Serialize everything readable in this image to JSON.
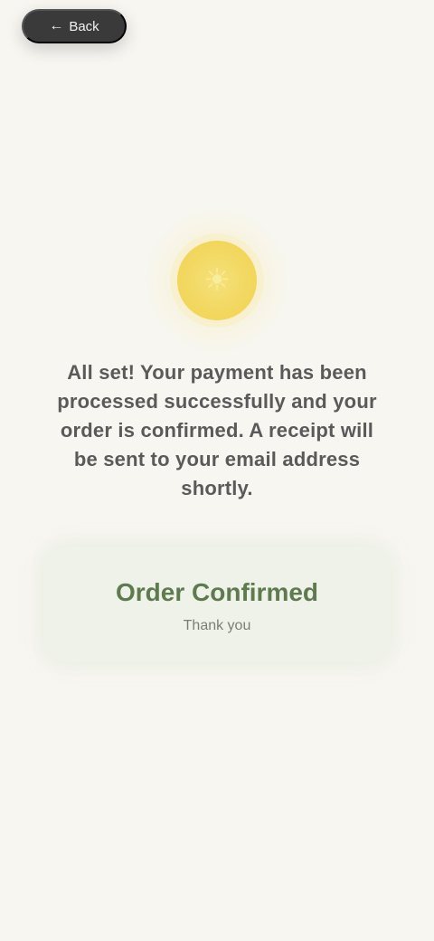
{
  "header": {
    "back_label": "Back"
  },
  "hero": {
    "icon_name": "sun-icon",
    "icon_glyph": "☀",
    "colors": {
      "glow": "#f7e07a",
      "icon": "#f2d861"
    }
  },
  "message": {
    "lines": [
      "All set! Your payment has been",
      "processed successfully and your",
      "order is confirmed. A receipt will",
      "be sent to your email address",
      "shortly."
    ]
  },
  "success": {
    "title": "Order Confirmed",
    "subtitle": "Thank you",
    "accent": "#5f7a4f",
    "background": "#eef2e8"
  }
}
